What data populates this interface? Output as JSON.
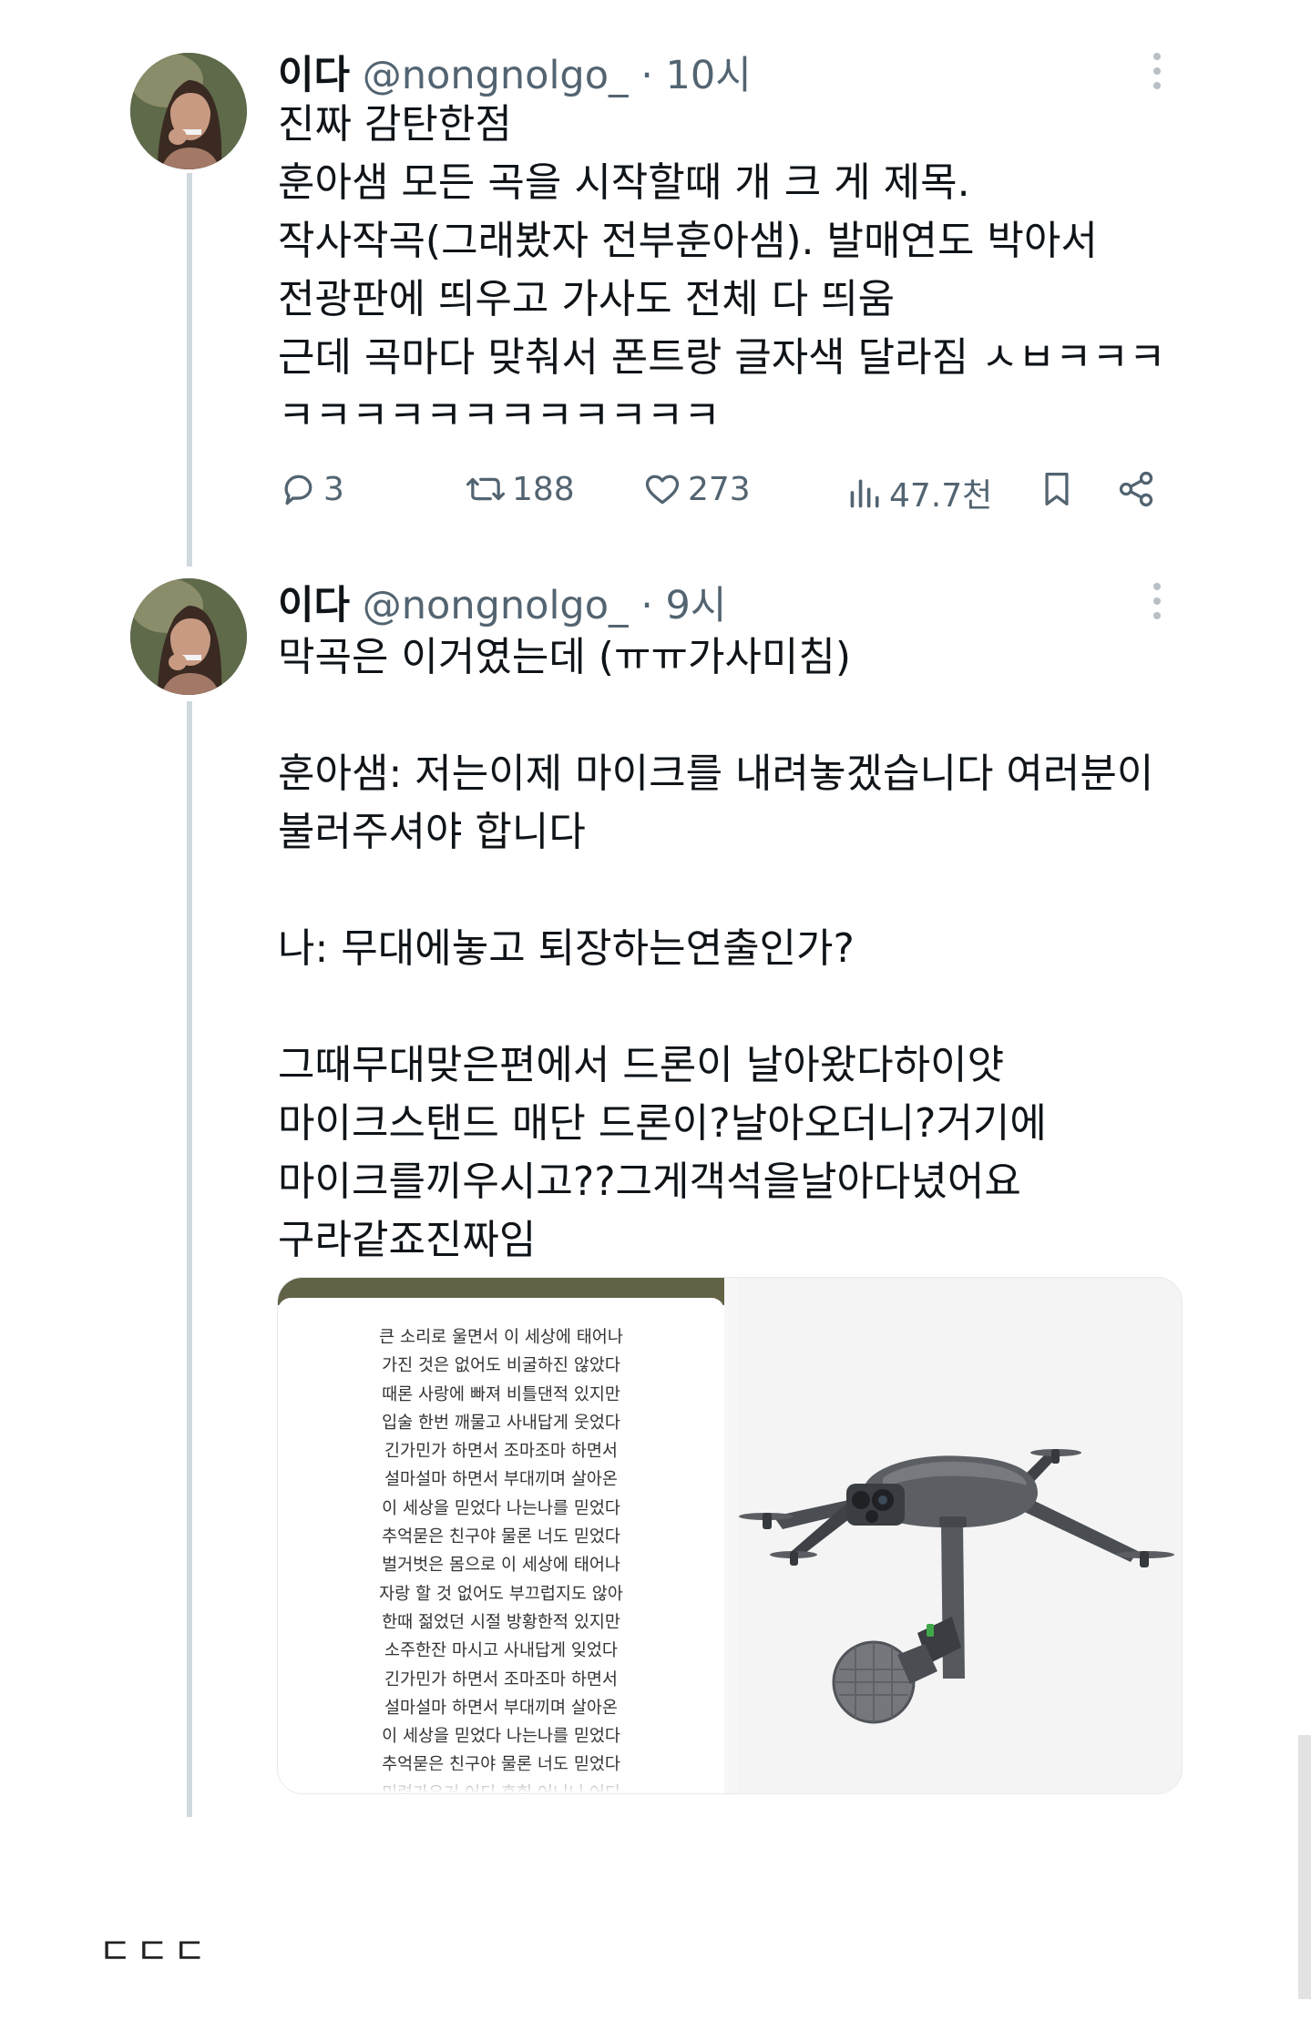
{
  "tweets": [
    {
      "name": "이다",
      "handle": "@nongnolgo_",
      "dot": "·",
      "time": "10시",
      "lines": [
        "진짜 감탄한점",
        "훈아샘 모든 곡을 시작할때 개 크 게 제목.",
        "작사작곡(그래봤자 전부훈아샘). 발매연도 박아서",
        "전광판에 띄우고 가사도 전체 다 띄움",
        "근데 곡마다 맞춰서 폰트랑 글자색 달라짐 ㅅㅂㅋㅋㅋ",
        "ㅋㅋㅋㅋㅋㅋㅋㅋㅋㅋㅋㅋ"
      ],
      "actions": {
        "replies": "3",
        "retweets": "188",
        "likes": "273",
        "views": "47.7천"
      }
    },
    {
      "name": "이다",
      "handle": "@nongnolgo_",
      "dot": "·",
      "time": "9시",
      "lines": [
        "막곡은 이거였는데 (ㅠㅠ가사미침)",
        "",
        "훈아샘: 저는이제 마이크를 내려놓겠습니다 여러분이",
        "불러주셔야 합니다",
        "",
        "나: 무대에놓고 퇴장하는연출인가?",
        "",
        "그때무대맞은편에서 드론이 날아왔다하이얏",
        "마이크스탠드 매단 드론이?날아오더니?거기에",
        "마이크를끼우시고??그게객석을날아다녔어요",
        "구라같죠진짜임"
      ],
      "media": {
        "lyrics": [
          "큰 소리로 울면서 이 세상에 태어나",
          "가진 것은 없어도 비굴하진 않았다",
          "때론 사랑에 빠져 비틀댄적 있지만",
          "입술 한번 깨물고 사내답게 웃었다",
          "긴가민가 하면서 조마조마 하면서",
          "설마설마 하면서 부대끼며 살아온",
          "이 세상을 믿었다 나는나를 믿었다",
          "추억묻은 친구야 물론 너도 믿었다",
          "벌거벗은 몸으로 이 세상에 태어나",
          "자랑 할 것 없어도 부끄럽지도 않아",
          "한때 젊었던 시절 방황한적 있지만",
          "소주한잔 마시고 사내답게 잊었다",
          "긴가민가 하면서 조마조마 하면서",
          "설마설마 하면서 부대끼며 살아온",
          "이 세상을 믿었다 나는나를 믿었다",
          "추억묻은 친구야 물론 너도 믿었다",
          "미련가우거 어디 후회 어니니 어디"
        ]
      }
    }
  ],
  "footer": "ㄷㄷㄷ",
  "colors": {
    "text": "#0f1419",
    "muted": "#536471",
    "thread_line": "#cfd9de",
    "lyrics_header": "#626246"
  },
  "icons": [
    "reply-icon",
    "retweet-icon",
    "like-icon",
    "views-icon",
    "bookmark-icon",
    "share-icon",
    "more-icon"
  ]
}
